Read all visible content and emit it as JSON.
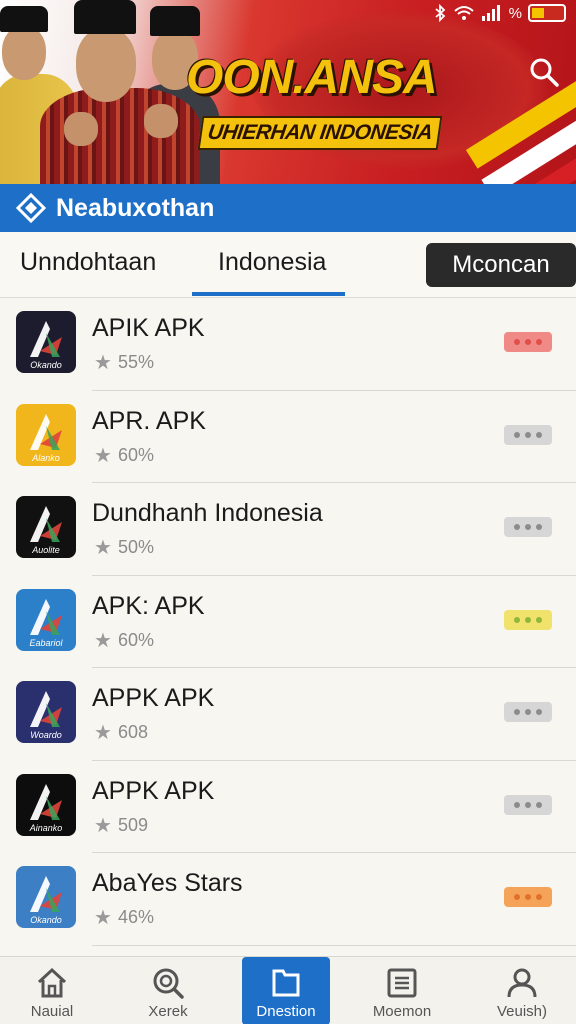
{
  "banner": {
    "title": "OON.ANSA",
    "subtitle": "UHIERHAN INDONESIA"
  },
  "status": {
    "icons": [
      "bluetooth-icon",
      "wifi-icon",
      "signal-icon",
      "battery-icon"
    ],
    "signal_text": "%"
  },
  "appbar": {
    "title": "Neabuxothan",
    "logo": "diamond-logo-icon"
  },
  "tabs": [
    {
      "label": "Unndohtaan",
      "selected": false
    },
    {
      "label": "Indonesia",
      "selected": true
    }
  ],
  "tab_button": {
    "label": "Mconcan"
  },
  "apps": [
    {
      "name": "APIK APK",
      "rating": "55%",
      "icon_label": "Okando",
      "icon_bg": "#1c1c2e",
      "dots_color": "#f08a86",
      "dot_fill": "#e24e48"
    },
    {
      "name": "APR. APK",
      "rating": "60%",
      "icon_label": "Alanko",
      "icon_bg": "#f2b61d",
      "dots_color": "#d6d6d6",
      "dot_fill": "#8c8c8c"
    },
    {
      "name": "Dundhanh Indonesia",
      "rating": "50%",
      "icon_label": "Auolite",
      "icon_bg": "#111111",
      "dots_color": "#d6d6d6",
      "dot_fill": "#8c8c8c"
    },
    {
      "name": "APK: APK",
      "rating": "60%",
      "icon_label": "Eabariol",
      "icon_bg": "#2c7fc9",
      "dots_color": "#f0e26a",
      "dot_fill": "#8fb83a"
    },
    {
      "name": "APPK APK",
      "rating": "608",
      "icon_label": "Woardo",
      "icon_bg": "#2a2f6e",
      "dots_color": "#d6d6d6",
      "dot_fill": "#8c8c8c"
    },
    {
      "name": "APPK APK",
      "rating": "509",
      "icon_label": "Ainanko",
      "icon_bg": "#0d0d0d",
      "dots_color": "#d6d6d6",
      "dot_fill": "#8c8c8c"
    },
    {
      "name": "AbaYes Stars",
      "rating": "46%",
      "icon_label": "Okando",
      "icon_bg": "#3d7fc4",
      "dots_color": "#f6a35a",
      "dot_fill": "#e0712a"
    }
  ],
  "bottomnav": [
    {
      "label": "Nauial",
      "icon": "home-icon",
      "active": false
    },
    {
      "label": "Xerek",
      "icon": "search-icon",
      "active": false
    },
    {
      "label": "Dnestion",
      "icon": "folder-icon",
      "active": true
    },
    {
      "label": "Moemon",
      "icon": "list-icon",
      "active": false
    },
    {
      "label": "Veuish)",
      "icon": "user-icon",
      "active": false
    }
  ]
}
